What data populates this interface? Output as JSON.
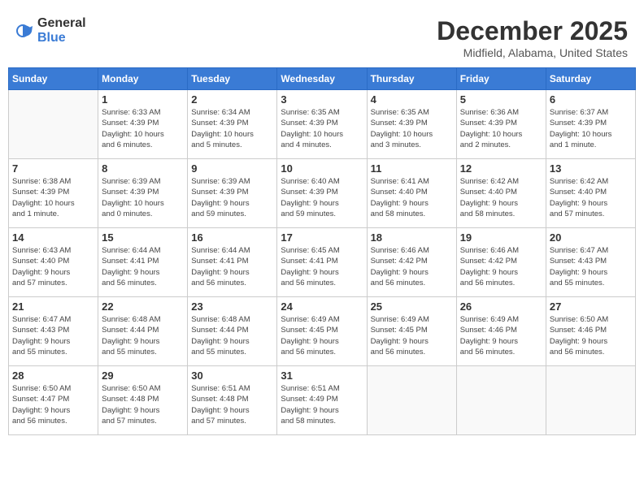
{
  "header": {
    "logo_general": "General",
    "logo_blue": "Blue",
    "month": "December 2025",
    "location": "Midfield, Alabama, United States"
  },
  "weekdays": [
    "Sunday",
    "Monday",
    "Tuesday",
    "Wednesday",
    "Thursday",
    "Friday",
    "Saturday"
  ],
  "weeks": [
    [
      {
        "day": "",
        "info": ""
      },
      {
        "day": "1",
        "info": "Sunrise: 6:33 AM\nSunset: 4:39 PM\nDaylight: 10 hours\nand 6 minutes."
      },
      {
        "day": "2",
        "info": "Sunrise: 6:34 AM\nSunset: 4:39 PM\nDaylight: 10 hours\nand 5 minutes."
      },
      {
        "day": "3",
        "info": "Sunrise: 6:35 AM\nSunset: 4:39 PM\nDaylight: 10 hours\nand 4 minutes."
      },
      {
        "day": "4",
        "info": "Sunrise: 6:35 AM\nSunset: 4:39 PM\nDaylight: 10 hours\nand 3 minutes."
      },
      {
        "day": "5",
        "info": "Sunrise: 6:36 AM\nSunset: 4:39 PM\nDaylight: 10 hours\nand 2 minutes."
      },
      {
        "day": "6",
        "info": "Sunrise: 6:37 AM\nSunset: 4:39 PM\nDaylight: 10 hours\nand 1 minute."
      }
    ],
    [
      {
        "day": "7",
        "info": "Sunrise: 6:38 AM\nSunset: 4:39 PM\nDaylight: 10 hours\nand 1 minute."
      },
      {
        "day": "8",
        "info": "Sunrise: 6:39 AM\nSunset: 4:39 PM\nDaylight: 10 hours\nand 0 minutes."
      },
      {
        "day": "9",
        "info": "Sunrise: 6:39 AM\nSunset: 4:39 PM\nDaylight: 9 hours\nand 59 minutes."
      },
      {
        "day": "10",
        "info": "Sunrise: 6:40 AM\nSunset: 4:39 PM\nDaylight: 9 hours\nand 59 minutes."
      },
      {
        "day": "11",
        "info": "Sunrise: 6:41 AM\nSunset: 4:40 PM\nDaylight: 9 hours\nand 58 minutes."
      },
      {
        "day": "12",
        "info": "Sunrise: 6:42 AM\nSunset: 4:40 PM\nDaylight: 9 hours\nand 58 minutes."
      },
      {
        "day": "13",
        "info": "Sunrise: 6:42 AM\nSunset: 4:40 PM\nDaylight: 9 hours\nand 57 minutes."
      }
    ],
    [
      {
        "day": "14",
        "info": "Sunrise: 6:43 AM\nSunset: 4:40 PM\nDaylight: 9 hours\nand 57 minutes."
      },
      {
        "day": "15",
        "info": "Sunrise: 6:44 AM\nSunset: 4:41 PM\nDaylight: 9 hours\nand 56 minutes."
      },
      {
        "day": "16",
        "info": "Sunrise: 6:44 AM\nSunset: 4:41 PM\nDaylight: 9 hours\nand 56 minutes."
      },
      {
        "day": "17",
        "info": "Sunrise: 6:45 AM\nSunset: 4:41 PM\nDaylight: 9 hours\nand 56 minutes."
      },
      {
        "day": "18",
        "info": "Sunrise: 6:46 AM\nSunset: 4:42 PM\nDaylight: 9 hours\nand 56 minutes."
      },
      {
        "day": "19",
        "info": "Sunrise: 6:46 AM\nSunset: 4:42 PM\nDaylight: 9 hours\nand 56 minutes."
      },
      {
        "day": "20",
        "info": "Sunrise: 6:47 AM\nSunset: 4:43 PM\nDaylight: 9 hours\nand 55 minutes."
      }
    ],
    [
      {
        "day": "21",
        "info": "Sunrise: 6:47 AM\nSunset: 4:43 PM\nDaylight: 9 hours\nand 55 minutes."
      },
      {
        "day": "22",
        "info": "Sunrise: 6:48 AM\nSunset: 4:44 PM\nDaylight: 9 hours\nand 55 minutes."
      },
      {
        "day": "23",
        "info": "Sunrise: 6:48 AM\nSunset: 4:44 PM\nDaylight: 9 hours\nand 55 minutes."
      },
      {
        "day": "24",
        "info": "Sunrise: 6:49 AM\nSunset: 4:45 PM\nDaylight: 9 hours\nand 56 minutes."
      },
      {
        "day": "25",
        "info": "Sunrise: 6:49 AM\nSunset: 4:45 PM\nDaylight: 9 hours\nand 56 minutes."
      },
      {
        "day": "26",
        "info": "Sunrise: 6:49 AM\nSunset: 4:46 PM\nDaylight: 9 hours\nand 56 minutes."
      },
      {
        "day": "27",
        "info": "Sunrise: 6:50 AM\nSunset: 4:46 PM\nDaylight: 9 hours\nand 56 minutes."
      }
    ],
    [
      {
        "day": "28",
        "info": "Sunrise: 6:50 AM\nSunset: 4:47 PM\nDaylight: 9 hours\nand 56 minutes."
      },
      {
        "day": "29",
        "info": "Sunrise: 6:50 AM\nSunset: 4:48 PM\nDaylight: 9 hours\nand 57 minutes."
      },
      {
        "day": "30",
        "info": "Sunrise: 6:51 AM\nSunset: 4:48 PM\nDaylight: 9 hours\nand 57 minutes."
      },
      {
        "day": "31",
        "info": "Sunrise: 6:51 AM\nSunset: 4:49 PM\nDaylight: 9 hours\nand 58 minutes."
      },
      {
        "day": "",
        "info": ""
      },
      {
        "day": "",
        "info": ""
      },
      {
        "day": "",
        "info": ""
      }
    ]
  ]
}
